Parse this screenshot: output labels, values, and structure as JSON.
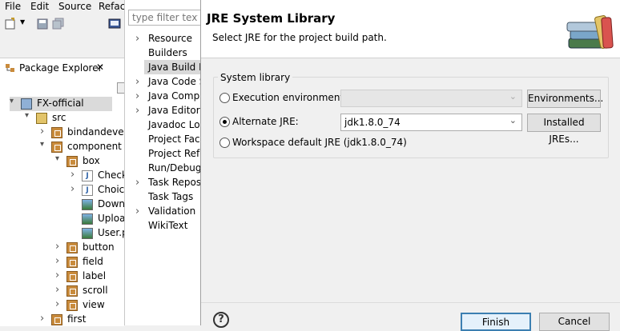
{
  "menubar": {
    "items": [
      "File",
      "Edit",
      "Source",
      "Refac"
    ]
  },
  "package_explorer": {
    "tab_label": "Package Explorer",
    "close_glyph": "✕",
    "tree": [
      {
        "label": "FX-official",
        "icon": "project-icon",
        "twisty": "▾",
        "depth": 0,
        "selected": true
      },
      {
        "label": "src",
        "icon": "source-folder-icon",
        "twisty": "▾",
        "depth": 1
      },
      {
        "label": "bindandeven",
        "icon": "package-icon",
        "twisty": "›",
        "depth": 2
      },
      {
        "label": "component",
        "icon": "package-icon",
        "twisty": "▾",
        "depth": 2
      },
      {
        "label": "box",
        "icon": "package-icon",
        "twisty": "▾",
        "depth": 3
      },
      {
        "label": "Check",
        "icon": "java-file-icon",
        "twisty": "›",
        "depth": 4
      },
      {
        "label": "Choic",
        "icon": "java-file-icon",
        "twisty": "›",
        "depth": 4
      },
      {
        "label": "Down",
        "icon": "image-file-icon",
        "twisty": "",
        "depth": 4
      },
      {
        "label": "Uploa",
        "icon": "image-file-icon",
        "twisty": "",
        "depth": 4
      },
      {
        "label": "User.p",
        "icon": "image-file-icon",
        "twisty": "",
        "depth": 4
      },
      {
        "label": "button",
        "icon": "package-icon",
        "twisty": "›",
        "depth": 3
      },
      {
        "label": "field",
        "icon": "package-icon",
        "twisty": "›",
        "depth": 3
      },
      {
        "label": "label",
        "icon": "package-icon",
        "twisty": "›",
        "depth": 3
      },
      {
        "label": "scroll",
        "icon": "package-icon",
        "twisty": "›",
        "depth": 3
      },
      {
        "label": "view",
        "icon": "package-icon",
        "twisty": "›",
        "depth": 3
      },
      {
        "label": "first",
        "icon": "package-icon",
        "twisty": "›",
        "depth": 2
      }
    ]
  },
  "properties": {
    "filter_placeholder": "type filter text",
    "items": [
      {
        "label": "Resource",
        "twisty": "›"
      },
      {
        "label": "Builders",
        "twisty": ""
      },
      {
        "label": "Java Build Pa",
        "twisty": "",
        "selected": true
      },
      {
        "label": "Java Code St",
        "twisty": "›"
      },
      {
        "label": "Java Compil",
        "twisty": "›"
      },
      {
        "label": "Java Editor",
        "twisty": "›"
      },
      {
        "label": "Javadoc Loc",
        "twisty": ""
      },
      {
        "label": "Project Face",
        "twisty": ""
      },
      {
        "label": "Project Refer",
        "twisty": ""
      },
      {
        "label": "Run/Debug",
        "twisty": ""
      },
      {
        "label": "Task Reposit",
        "twisty": "›"
      },
      {
        "label": "Task Tags",
        "twisty": ""
      },
      {
        "label": "Validation",
        "twisty": "›"
      },
      {
        "label": "WikiText",
        "twisty": ""
      }
    ]
  },
  "dialog": {
    "title": "JRE System Library",
    "message": "Select JRE for the project build path.",
    "group_label": "System library",
    "options": [
      {
        "label": "Execution environment:",
        "checked": false,
        "combo_value": "",
        "combo_enabled": false,
        "button": "Environments..."
      },
      {
        "label": "Alternate JRE:",
        "checked": true,
        "combo_value": "jdk1.8.0_74",
        "combo_enabled": true,
        "button": "Installed JREs..."
      },
      {
        "label": "Workspace default JRE (jdk1.8.0_74)",
        "checked": false
      }
    ],
    "help_glyph": "?",
    "finish_label": "Finish",
    "cancel_label": "Cancel"
  }
}
